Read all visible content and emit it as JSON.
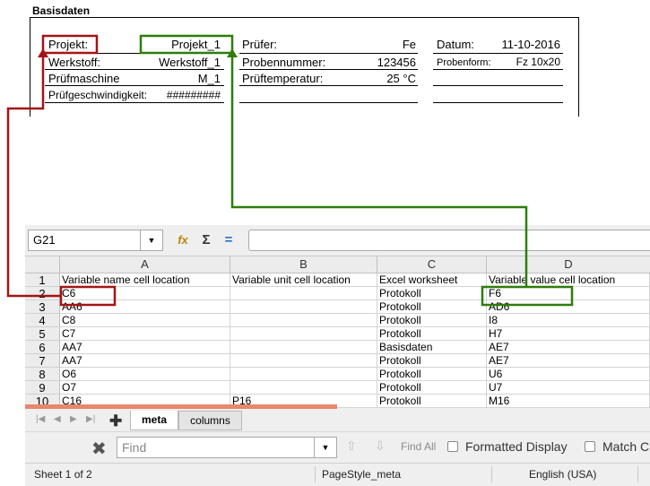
{
  "basisdaten": {
    "title": "Basisdaten",
    "projekt_label": "Projekt:",
    "projekt_value": "Projekt_1",
    "werkstoff_label": "Werkstoff:",
    "werkstoff_value": "Werkstoff_1",
    "pruefmaschine_label": "Prüfmaschine",
    "pruefmaschine_value": "M_1",
    "pruefgeschwindigkeit_label": "Prüfgeschwindigkeit:",
    "pruefgeschwindigkeit_value": "#########",
    "pruefer_label": "Prüfer:",
    "pruefer_value": "Fe",
    "probennummer_label": "Probennummer:",
    "probennummer_value": "123456",
    "prueftemperatur_label": "Prüftemperatur:",
    "prueftemperatur_value": "25 °C",
    "datum_label": "Datum:",
    "datum_value": "11-10-2016",
    "probenform_label": "Probenform:",
    "probenform_value": "Fz 10x20"
  },
  "formula_bar": {
    "cell_ref": "G21",
    "function_wizard_icon": "function-wizard-icon",
    "sum_icon": "sigma-icon",
    "formula_icon": "equals-icon",
    "formula_value": ""
  },
  "grid": {
    "columns": [
      "A",
      "B",
      "C",
      "D"
    ],
    "rows": [
      {
        "num": "1",
        "cells": [
          "Variable name cell location",
          "Variable unit cell location",
          "Excel worksheet",
          "Variable value cell location"
        ]
      },
      {
        "num": "2",
        "cells": [
          "C6",
          "",
          "Protokoll",
          "F6"
        ]
      },
      {
        "num": "3",
        "cells": [
          "AA6",
          "",
          "Protokoll",
          "AD6"
        ]
      },
      {
        "num": "4",
        "cells": [
          "C8",
          "",
          "Protokoll",
          "I8"
        ]
      },
      {
        "num": "5",
        "cells": [
          "C7",
          "",
          "Protokoll",
          "H7"
        ]
      },
      {
        "num": "6",
        "cells": [
          "AA7",
          "",
          "Basisdaten",
          "AE7"
        ]
      },
      {
        "num": "7",
        "cells": [
          "AA7",
          "",
          "Protokoll",
          "AE7"
        ]
      },
      {
        "num": "8",
        "cells": [
          "O6",
          "",
          "Protokoll",
          "U6"
        ]
      },
      {
        "num": "9",
        "cells": [
          "O7",
          "",
          "Protokoll",
          "U7"
        ]
      },
      {
        "num": "10",
        "cells": [
          "C16",
          "P16",
          "Protokoll",
          "M16"
        ]
      }
    ]
  },
  "sheet_tabs": {
    "add_icon": "plus-icon",
    "tabs": [
      "meta",
      "columns"
    ],
    "active": "meta"
  },
  "find_toolbar": {
    "close_icon": "close-x-icon",
    "placeholder": "Find",
    "find_all": "Find All",
    "formatted_display": "Formatted Display",
    "match_case": "Match C"
  },
  "status_bar": {
    "sheet_info": "Sheet 1 of 2",
    "page_style": "PageStyle_meta",
    "language": "English (USA)"
  },
  "annotation_colors": {
    "red": "#a31515",
    "green": "#2e7d0a"
  }
}
